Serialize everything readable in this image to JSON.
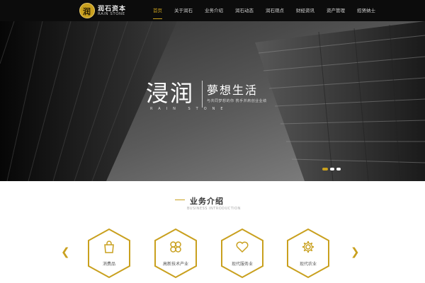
{
  "nav": {
    "brand_cn": "润石资本",
    "brand_en": "RAIN STONE",
    "logo_char": "润",
    "items": [
      "首页",
      "关于润石",
      "业务介绍",
      "润石动态",
      "润石观点",
      "财经资讯",
      "资产管理",
      "招贤纳士"
    ],
    "active_index": 0
  },
  "hero": {
    "title_big": "浸润",
    "title_dream": "夢想生活",
    "subtitle": "与共同梦想的你 携手并肩创业业绩",
    "subtitle_en": "RAIN STONE",
    "slides": 3,
    "active_slide": 0
  },
  "section": {
    "title": "业务介绍",
    "title_en": "BUSINESS INTRODUCTION"
  },
  "cards": [
    {
      "label": "消费品",
      "icon": "shopping-bag-icon"
    },
    {
      "label": "高新技术产业",
      "icon": "clover-icon"
    },
    {
      "label": "现代服务业",
      "icon": "heart-icon"
    },
    {
      "label": "现代农业",
      "icon": "gear-icon"
    }
  ],
  "colors": {
    "accent": "#c9a01e",
    "nav_bg": "#0c0c0c",
    "text_dark": "#333333",
    "text_muted": "#555555"
  }
}
